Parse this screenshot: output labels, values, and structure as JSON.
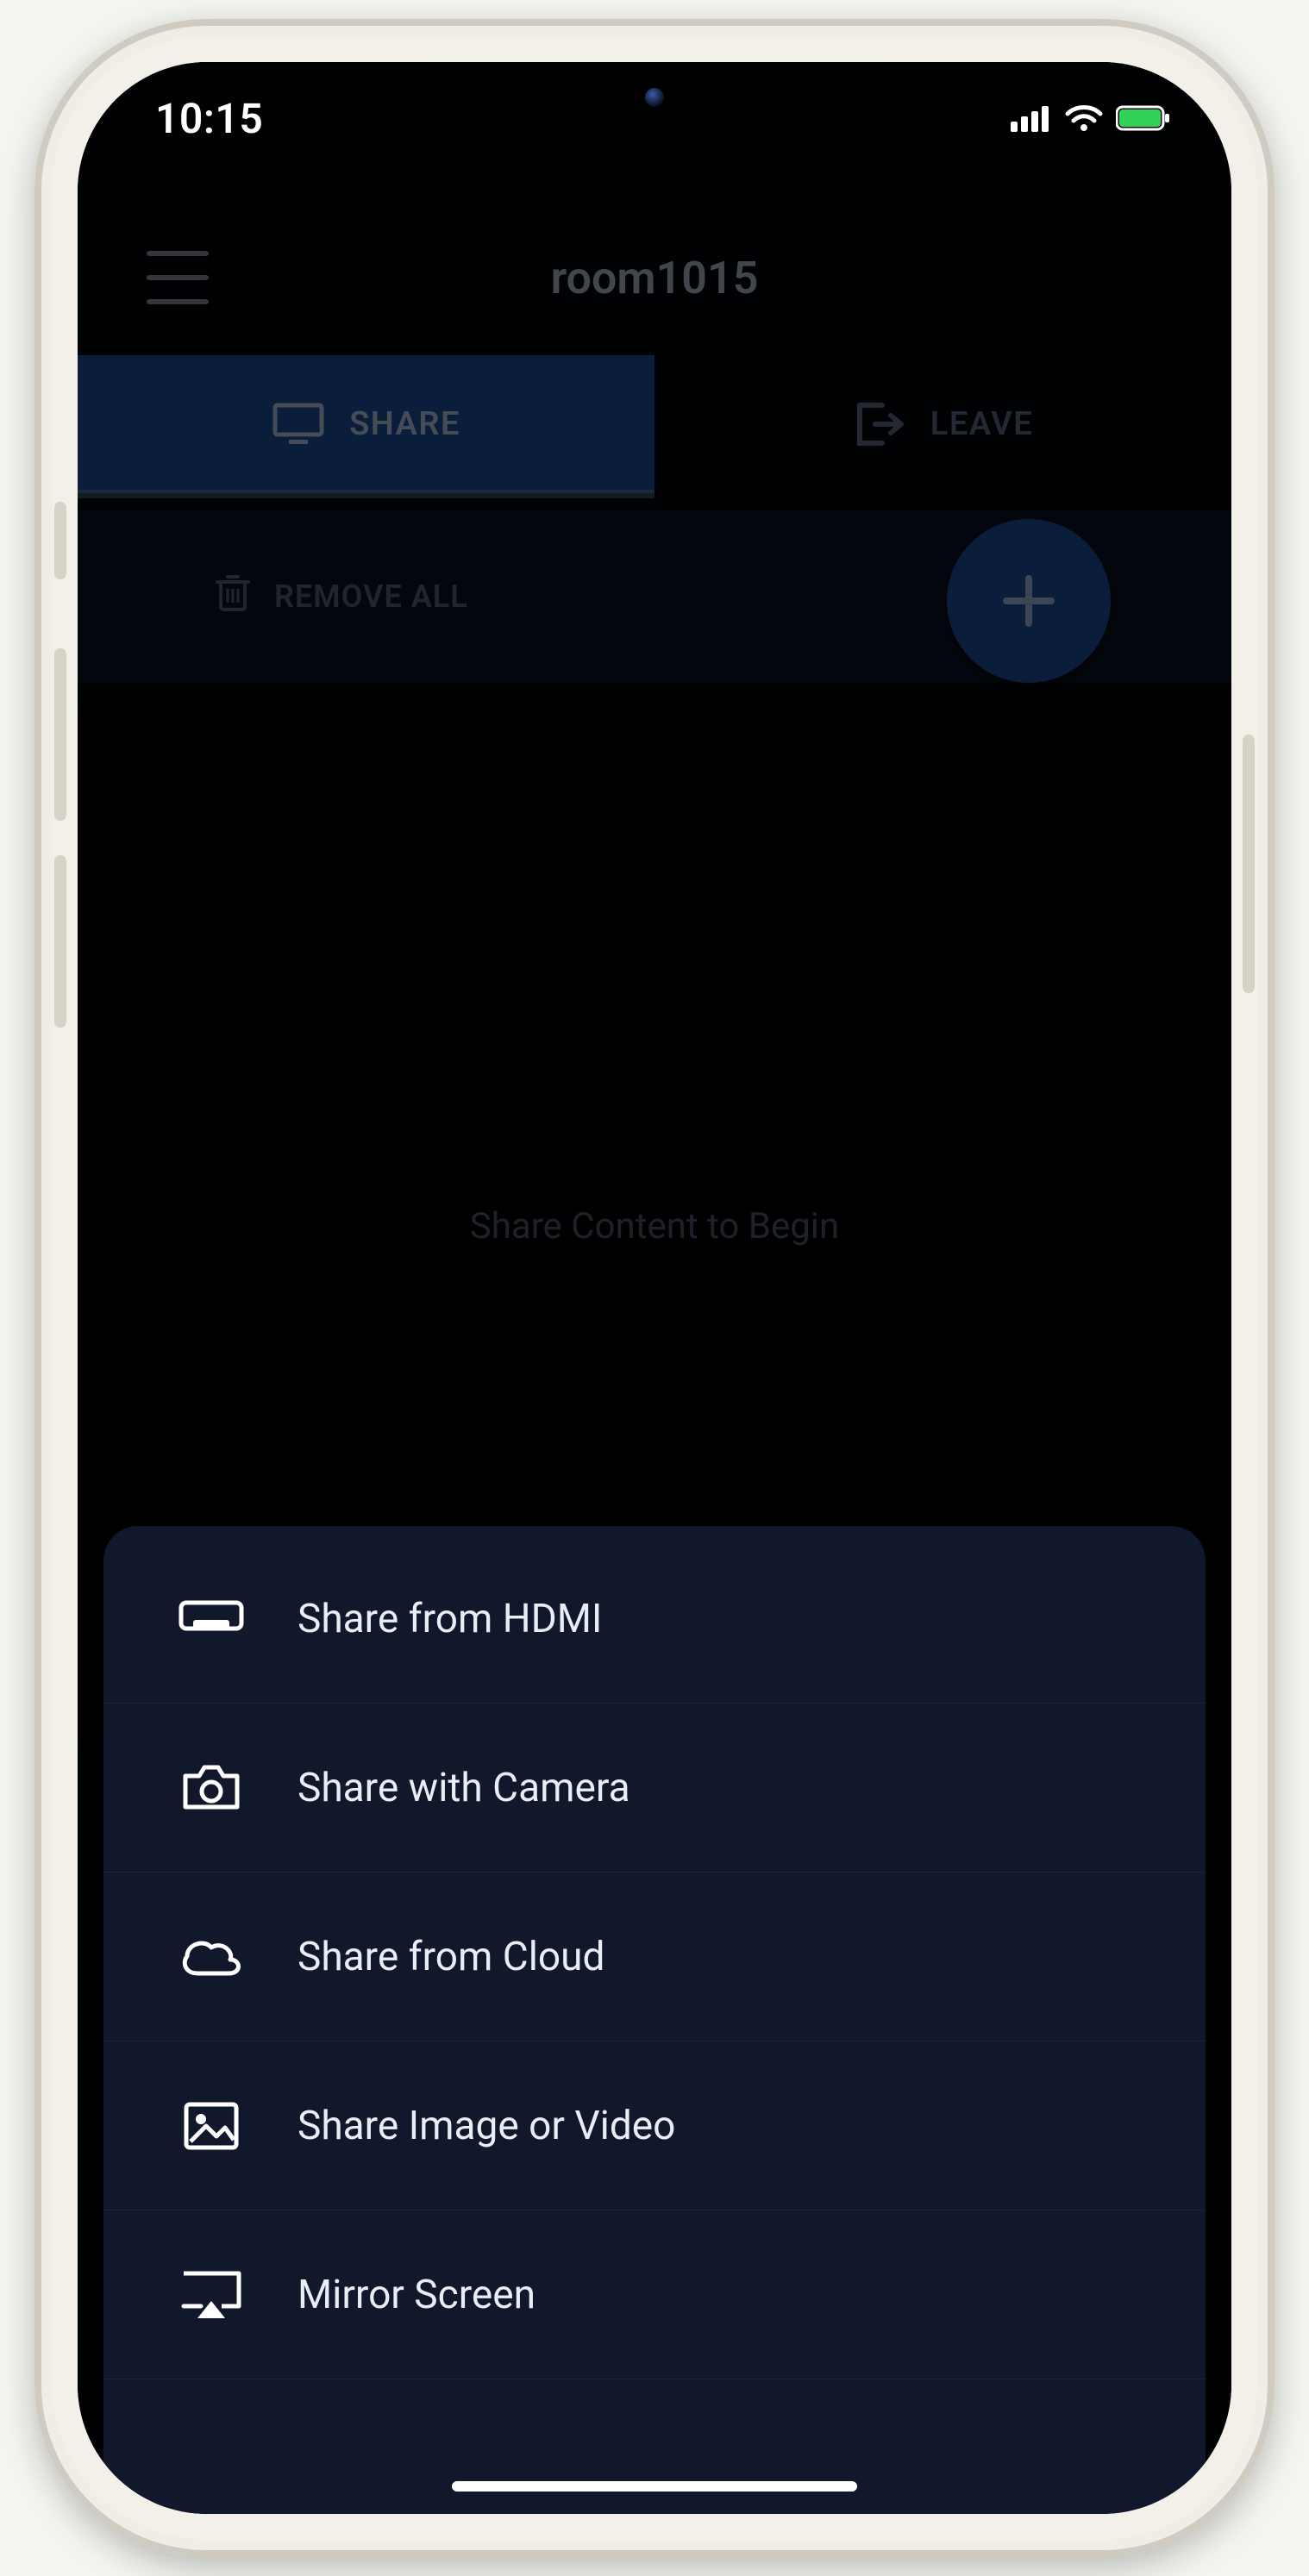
{
  "statusbar": {
    "time": "10:15"
  },
  "header": {
    "title": "room1015"
  },
  "tabs": {
    "share": "SHARE",
    "leave": "LEAVE"
  },
  "toolbar": {
    "remove_all": "REMOVE ALL"
  },
  "empty_state": "Share Content to Begin",
  "sheet": {
    "items": [
      {
        "label": "Share from HDMI"
      },
      {
        "label": "Share with Camera"
      },
      {
        "label": "Share from Cloud"
      },
      {
        "label": "Share Image or Video"
      },
      {
        "label": "Mirror Screen"
      }
    ]
  },
  "colors": {
    "accent": "#1b4c9c",
    "sheet_bg": "#11182b"
  }
}
